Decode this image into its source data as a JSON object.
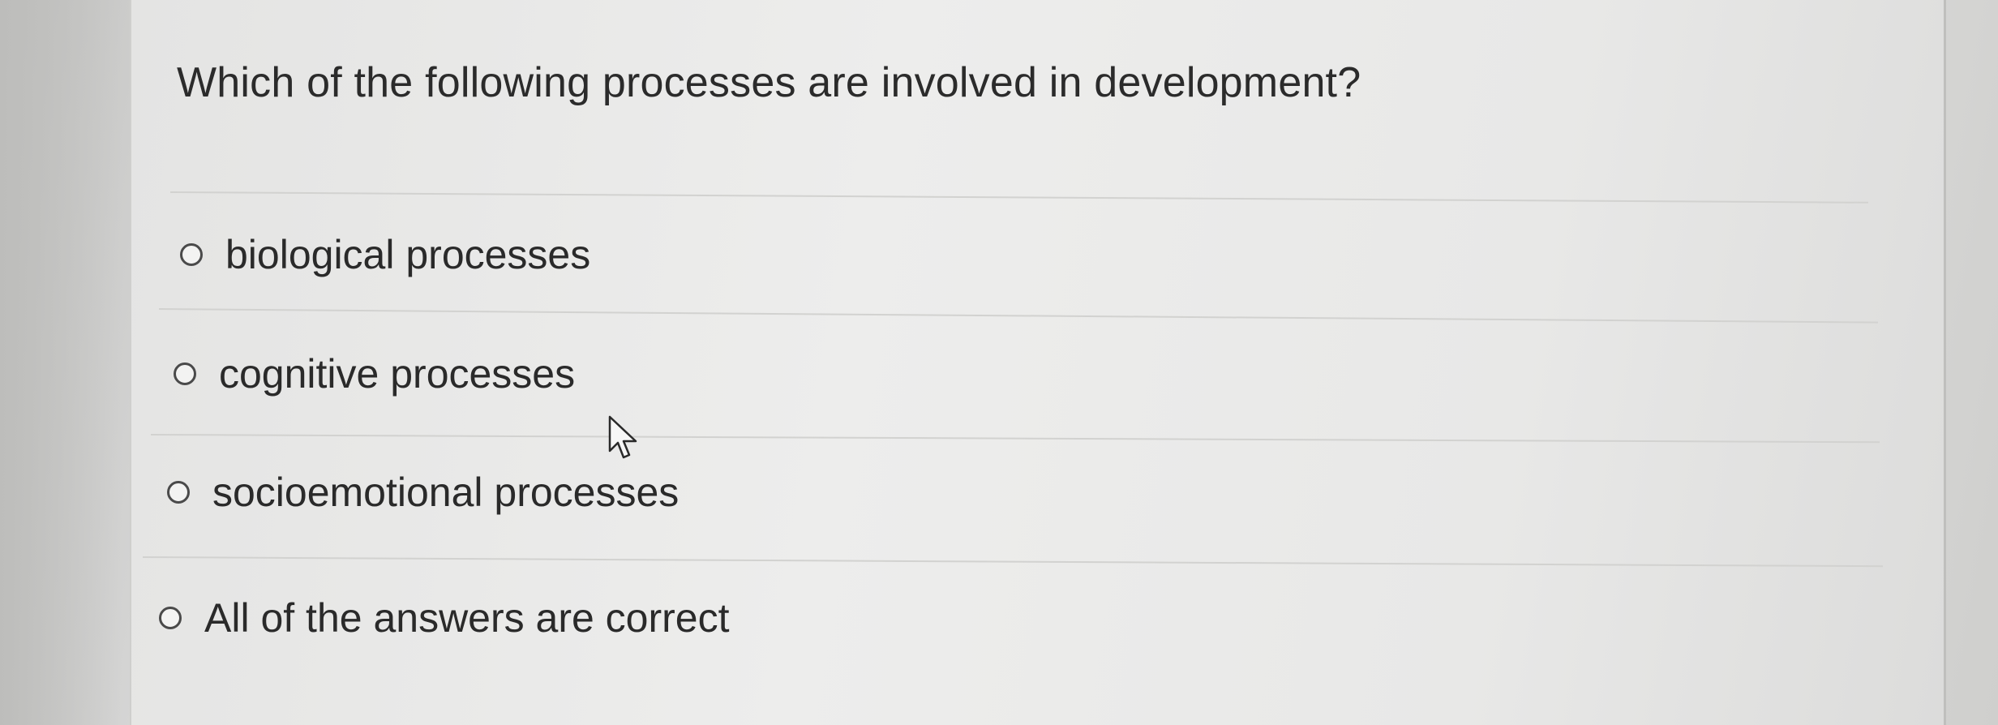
{
  "quiz": {
    "question": "Which of the following processes are involved in development?",
    "options": [
      {
        "label": "biological processes",
        "selected": false
      },
      {
        "label": "cognitive processes",
        "selected": false
      },
      {
        "label": "socioemotional processes",
        "selected": false
      },
      {
        "label": "All of the answers are correct",
        "selected": false
      }
    ]
  },
  "icons": {
    "option_marker": "radio-circle-icon",
    "pointer": "mouse-pointer-icon"
  }
}
